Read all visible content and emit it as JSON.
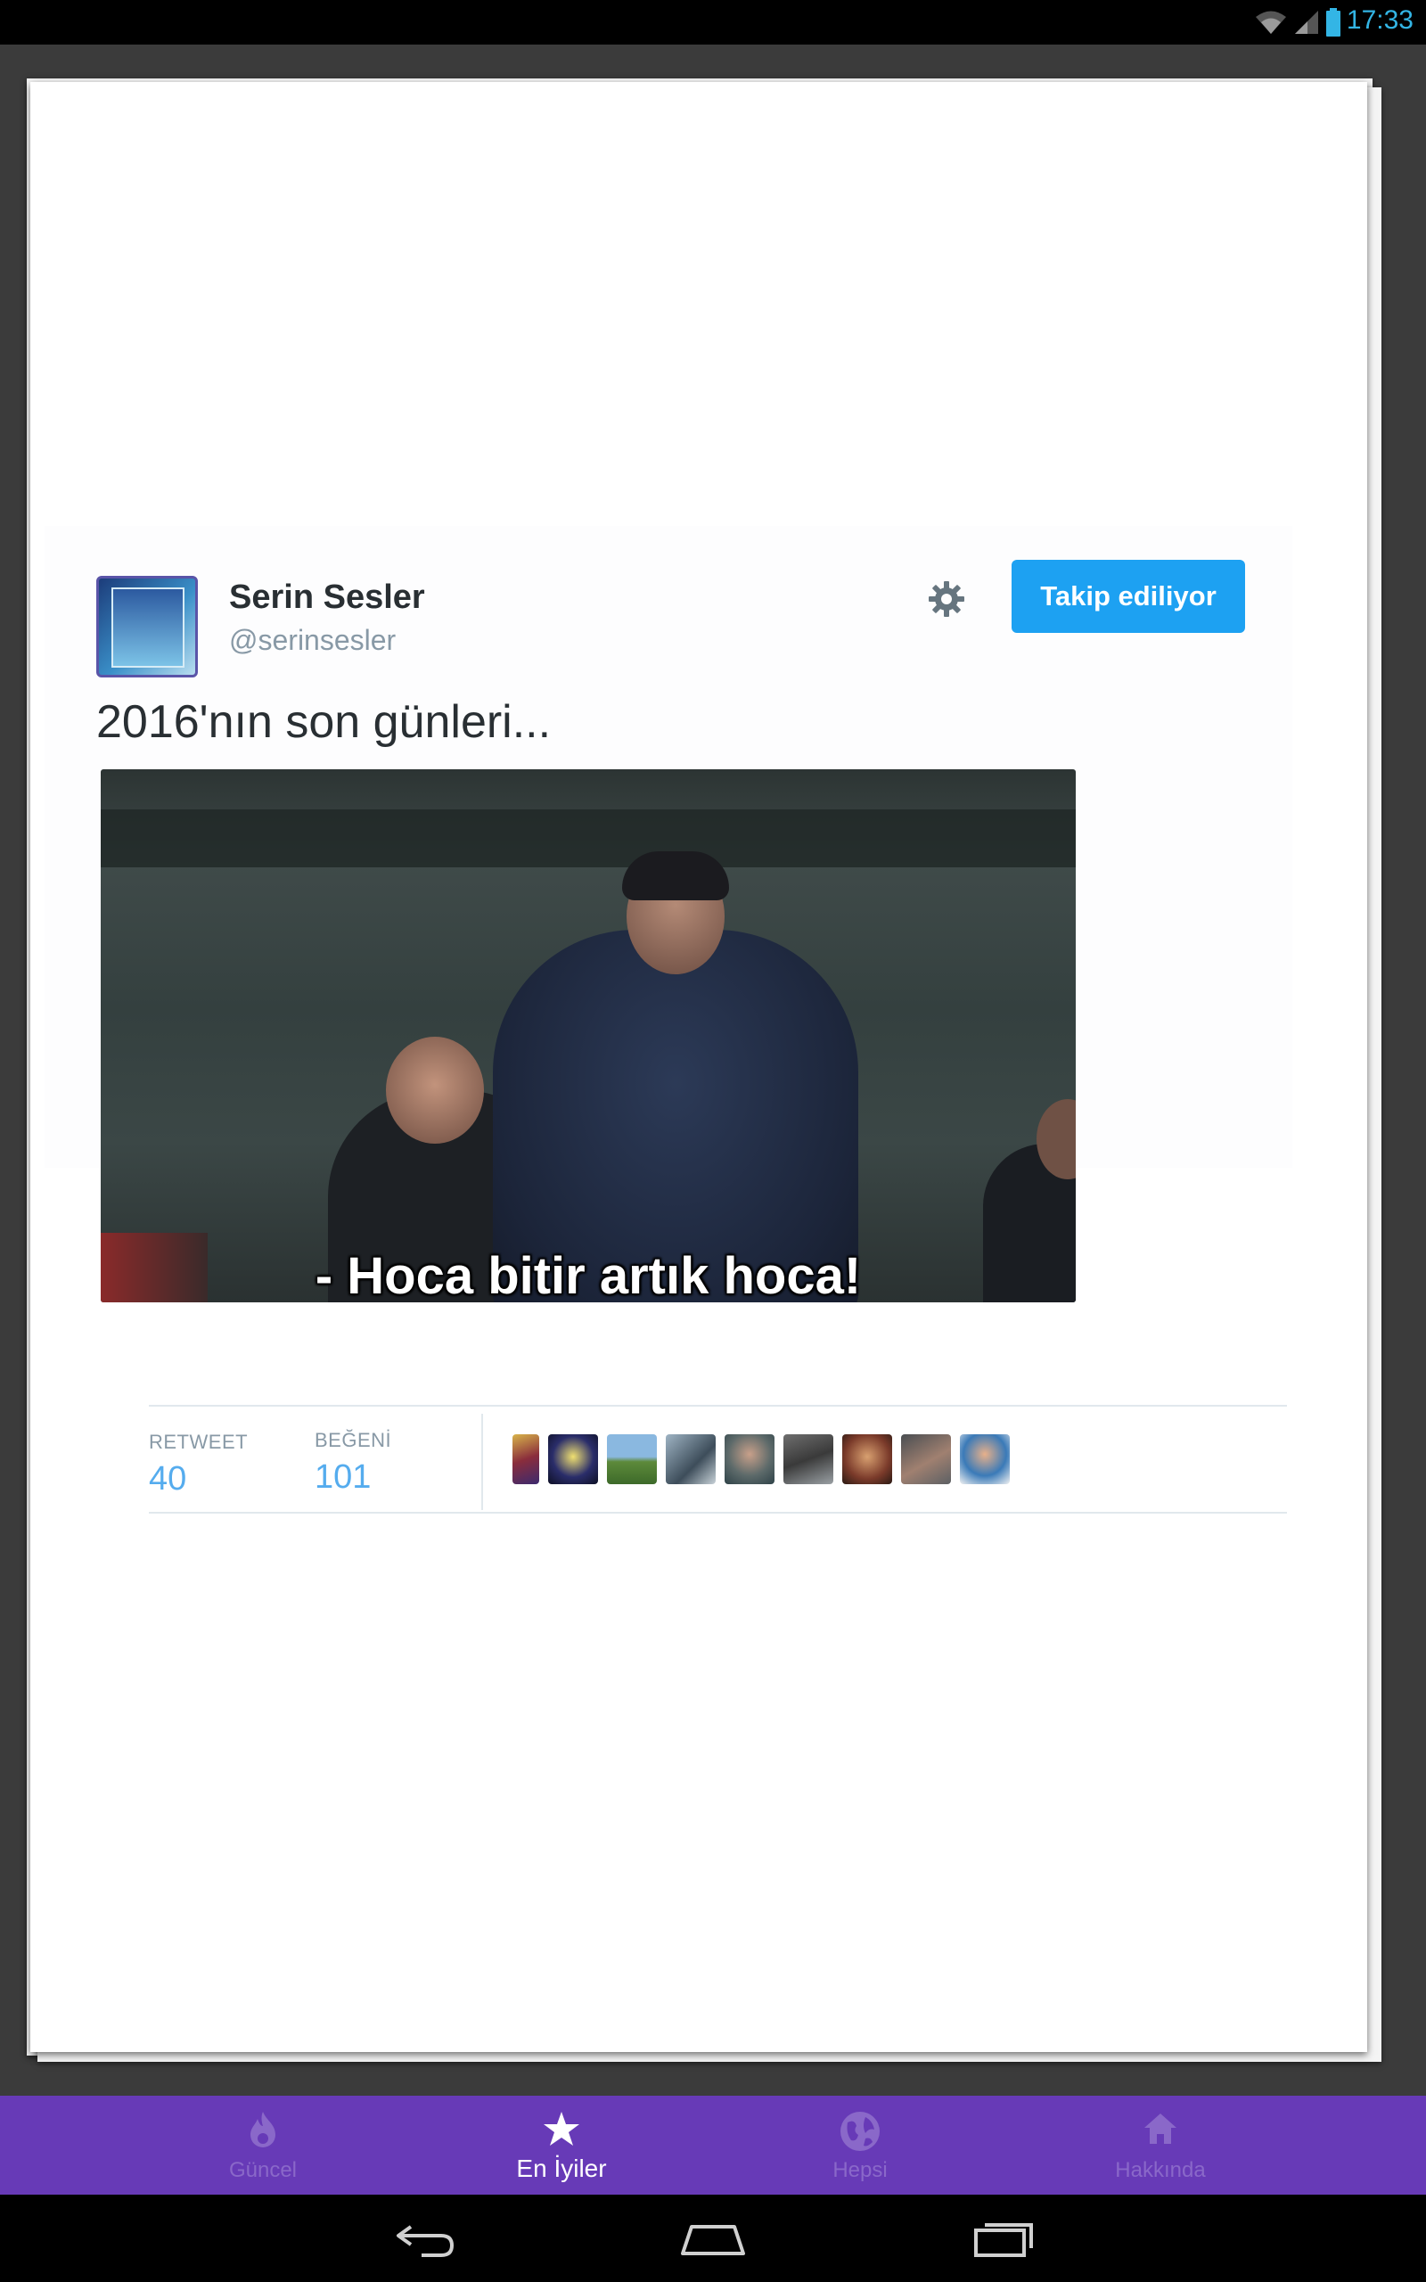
{
  "status_bar": {
    "time": "17:33",
    "icons": [
      "wifi-icon",
      "signal-icon",
      "battery-icon"
    ]
  },
  "tweet": {
    "author_name": "Serin Sesler",
    "author_handle": "@serinsesler",
    "follow_button_label": "Takip ediliyor",
    "text": "2016'nın son günleri...",
    "image_caption": "- Hoca bitir artık hoca!",
    "stats": {
      "retweet_label": "RETWEET",
      "retweet_count": "40",
      "like_label": "BEĞENİ",
      "like_count": "101"
    },
    "liker_avatar_count": 9
  },
  "bottom_nav": {
    "items": [
      {
        "label": "Güncel",
        "icon": "flame-icon",
        "active": false
      },
      {
        "label": "En İyiler",
        "icon": "star-icon",
        "active": true
      },
      {
        "label": "Hepsi",
        "icon": "globe-icon",
        "active": false
      },
      {
        "label": "Hakkında",
        "icon": "home-icon",
        "active": false
      }
    ]
  },
  "system_nav": {
    "buttons": [
      "back-icon",
      "home-icon",
      "recents-icon"
    ]
  },
  "colors": {
    "accent": "#673ab7",
    "follow_button": "#1da1f2",
    "stat_value": "#55acee",
    "status_icons": "#33b5e5"
  }
}
